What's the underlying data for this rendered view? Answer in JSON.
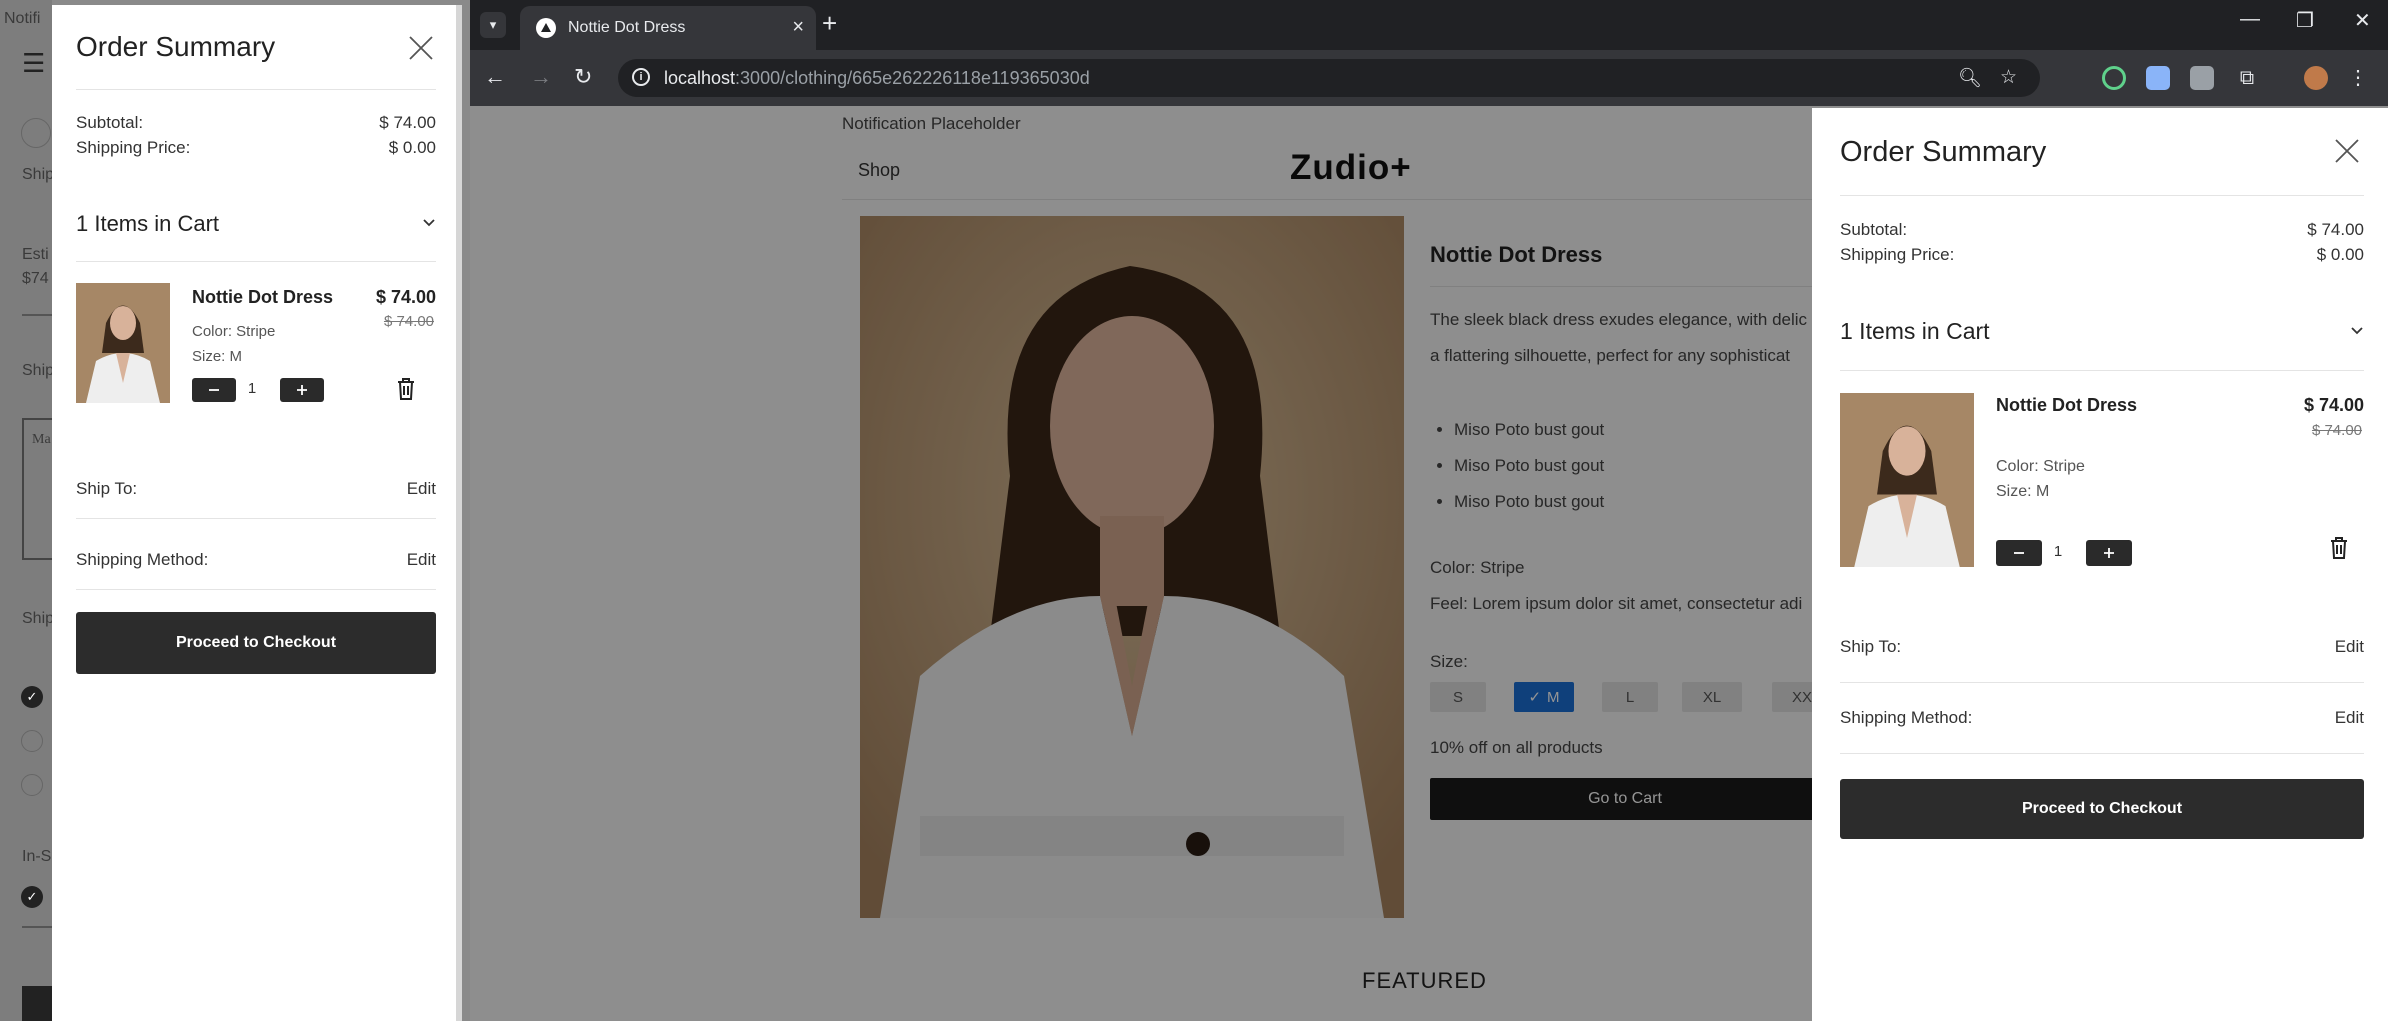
{
  "background_window": {
    "texts": [
      "Notifi",
      "Ship",
      "Esti",
      "$74",
      "Ship",
      "Ma",
      "Ship",
      "In-S"
    ]
  },
  "browser": {
    "tab_title": "Nottie Dot Dress",
    "url_host": "localhost",
    "url_path": ":3000/clothing/665e262226118e119365030d"
  },
  "page": {
    "notification": "Notification Placeholder",
    "nav_shop": "Shop",
    "logo": "Zudio+",
    "product_name": "Nottie Dot Dress",
    "description_lines": [
      "The sleek black dress exudes elegance, with delic",
      "a flattering silhouette, perfect for any sophisticat"
    ],
    "bullets": [
      "Miso Poto bust gout",
      "Miso Poto bust gout",
      "Miso Poto bust gout"
    ],
    "color_line": "Color: Stripe",
    "feel_line": "Feel: Lorem ipsum dolor sit amet, consectetur adi",
    "size_label": "Size:",
    "sizes": [
      "S",
      "M",
      "L",
      "XL",
      "XX"
    ],
    "selected_size": "M",
    "offer": "10% off on all products",
    "go_to_cart": "Go to Cart",
    "featured": "FEATURED"
  },
  "order_summary": {
    "title": "Order Summary",
    "subtotal_label": "Subtotal:",
    "subtotal_value": "$ 74.00",
    "shipping_label": "Shipping Price:",
    "shipping_value": "$ 0.00",
    "items_in_cart": "1 Items in Cart",
    "item": {
      "name": "Nottie Dot Dress",
      "price": "$ 74.00",
      "old_price": "$ 74.00",
      "color": "Color: Stripe",
      "size": "Size: M",
      "quantity": "1"
    },
    "ship_to_label": "Ship To:",
    "ship_to_action": "Edit",
    "shipping_method_label": "Shipping Method:",
    "shipping_method_action": "Edit",
    "checkout": "Proceed to Checkout"
  },
  "colors": {
    "accent_selected_size": "#1a6fd4",
    "dark_button": "#2c2c2c"
  }
}
